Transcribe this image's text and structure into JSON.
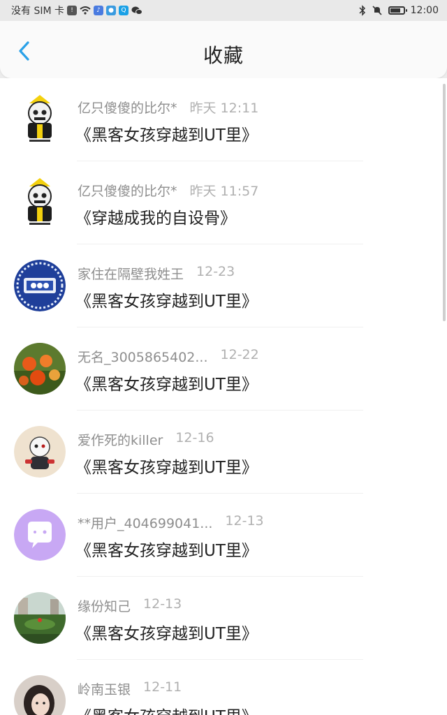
{
  "status_bar": {
    "carrier": "没有 SIM 卡",
    "time": "12:00"
  },
  "header": {
    "title": "收藏",
    "back_icon": "chevron-left-icon",
    "accent_color": "#2aa1e8"
  },
  "items": [
    {
      "name": "亿只傻傻的比尔*",
      "time": "昨天 12:11",
      "book": "《黑客女孩穿越到UT里》",
      "avatar": "skeleton-hat"
    },
    {
      "name": "亿只傻傻的比尔*",
      "time": "昨天 11:57",
      "book": "《穿越成我的自设骨》",
      "avatar": "skeleton-hat"
    },
    {
      "name": "家住在隔壁我姓王",
      "time": "12-23",
      "book": "《黑客女孩穿越到UT里》",
      "avatar": "520-badge"
    },
    {
      "name": "无名_3005865402...",
      "time": "12-22",
      "book": "《黑客女孩穿越到UT里》",
      "avatar": "flowers"
    },
    {
      "name": "爱作死的killer",
      "time": "12-16",
      "book": "《黑客女孩穿越到UT里》",
      "avatar": "character"
    },
    {
      "name": "**用户_404699041...",
      "time": "12-13",
      "book": "《黑客女孩穿越到UT里》",
      "avatar": "chat-bubble"
    },
    {
      "name": "缘份知己",
      "time": "12-13",
      "book": "《黑客女孩穿越到UT里》",
      "avatar": "landscape"
    },
    {
      "name": "岭南玉银",
      "time": "12-11",
      "book": "《黑客女孩穿越到UT里》",
      "avatar": "portrait"
    }
  ]
}
